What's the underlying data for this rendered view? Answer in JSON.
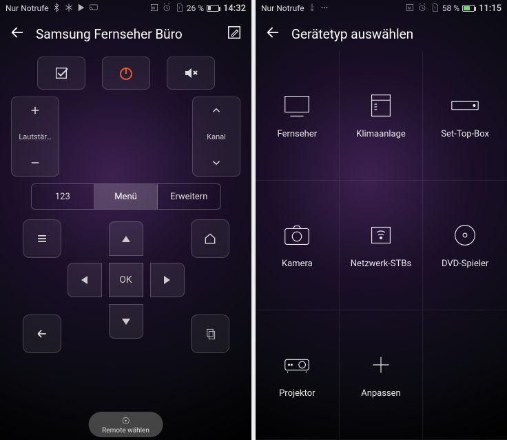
{
  "left": {
    "statusbar": {
      "carrier": "Nur Notrufe",
      "battery_pct": "26 %",
      "battery_fill_pct": 26,
      "time": "14:32"
    },
    "header": {
      "title": "Samsung Fernseher Büro"
    },
    "rockers": {
      "volume_label": "Lautstär…",
      "channel_label": "Kanal"
    },
    "segments": {
      "numpad": "123",
      "menu": "Menü",
      "extend": "Erweitern"
    },
    "dpad": {
      "ok": "OK"
    },
    "pill": {
      "label": "Remote wählen"
    }
  },
  "right": {
    "statusbar": {
      "carrier": "Nur Notrufe",
      "battery_pct": "58 %",
      "battery_fill_pct": 58,
      "time": "11:15"
    },
    "header": {
      "title": "Gerätetyp auswählen"
    },
    "devices": [
      {
        "label": "Fernseher"
      },
      {
        "label": "Klimaanlage"
      },
      {
        "label": "Set-Top-Box"
      },
      {
        "label": "Kamera"
      },
      {
        "label": "Netzwerk-STBs"
      },
      {
        "label": "DVD-Spieler"
      },
      {
        "label": "Projektor"
      },
      {
        "label": "Anpassen"
      }
    ]
  }
}
